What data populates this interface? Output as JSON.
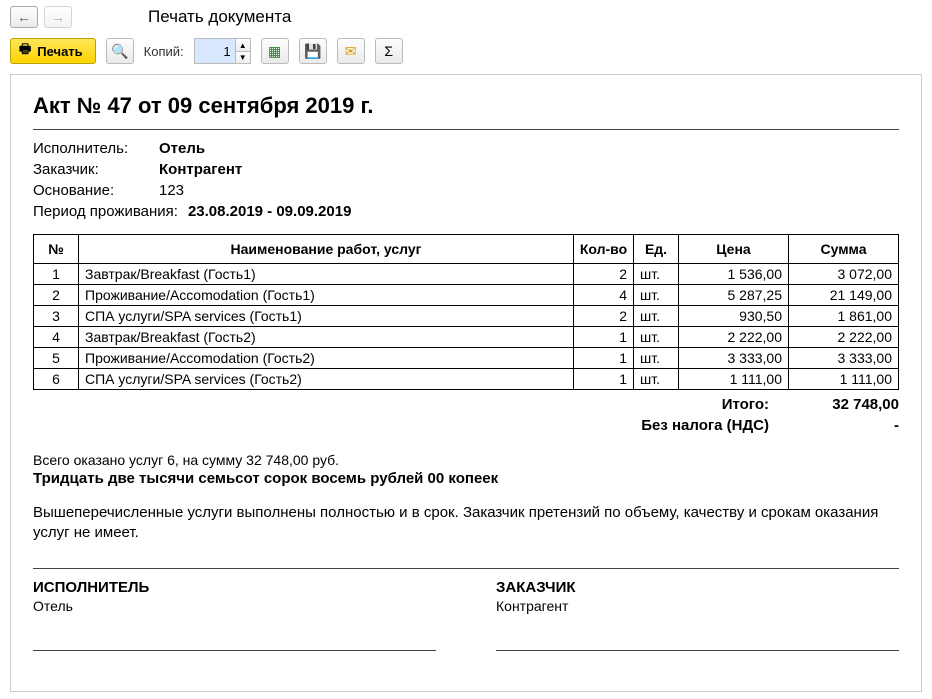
{
  "window": {
    "title": "Печать документа"
  },
  "toolbar": {
    "print_label": "Печать",
    "copies_label": "Копий:",
    "copies_value": "1"
  },
  "doc": {
    "title": "Акт № 47 от 09 сентября 2019 г.",
    "executor_label": "Исполнитель:",
    "executor_value": "Отель",
    "customer_label": "Заказчик:",
    "customer_value": "Контрагент",
    "basis_label": "Основание:",
    "basis_value": "123",
    "period_label": "Период проживания:",
    "period_value": "23.08.2019 - 09.09.2019"
  },
  "table": {
    "headers": {
      "num": "№",
      "name": "Наименование работ, услуг",
      "qty": "Кол-во",
      "unit": "Ед.",
      "price": "Цена",
      "sum": "Сумма"
    },
    "rows": [
      {
        "num": "1",
        "name": "Завтрак/Breakfast (Гость1)",
        "qty": "2",
        "unit": "шт.",
        "price": "1 536,00",
        "sum": "3 072,00"
      },
      {
        "num": "2",
        "name": "Проживание/Accomodation (Гость1)",
        "qty": "4",
        "unit": "шт.",
        "price": "5 287,25",
        "sum": "21 149,00"
      },
      {
        "num": "3",
        "name": "СПА услуги/SPA services (Гость1)",
        "qty": "2",
        "unit": "шт.",
        "price": "930,50",
        "sum": "1 861,00"
      },
      {
        "num": "4",
        "name": "Завтрак/Breakfast (Гость2)",
        "qty": "1",
        "unit": "шт.",
        "price": "2 222,00",
        "sum": "2 222,00"
      },
      {
        "num": "5",
        "name": "Проживание/Accomodation (Гость2)",
        "qty": "1",
        "unit": "шт.",
        "price": "3 333,00",
        "sum": "3 333,00"
      },
      {
        "num": "6",
        "name": "СПА услуги/SPA services (Гость2)",
        "qty": "1",
        "unit": "шт.",
        "price": "1 111,00",
        "sum": "1 111,00"
      }
    ]
  },
  "totals": {
    "total_label": "Итого:",
    "total_value": "32 748,00",
    "tax_label": "Без налога (НДС)",
    "tax_value": "-"
  },
  "summary": {
    "line1": "Всего оказано услуг 6, на сумму 32 748,00 руб.",
    "line2": "Тридцать две тысячи семьсот сорок восемь рублей 00 копеек",
    "confirm": "Вышеперечисленные услуги выполнены полностью и в срок. Заказчик претензий по объему, качеству и срокам оказания услуг не имеет."
  },
  "signatures": {
    "executor_role": "ИСПОЛНИТЕЛЬ",
    "executor_name": "Отель",
    "customer_role": "ЗАКАЗЧИК",
    "customer_name": "Контрагент"
  }
}
